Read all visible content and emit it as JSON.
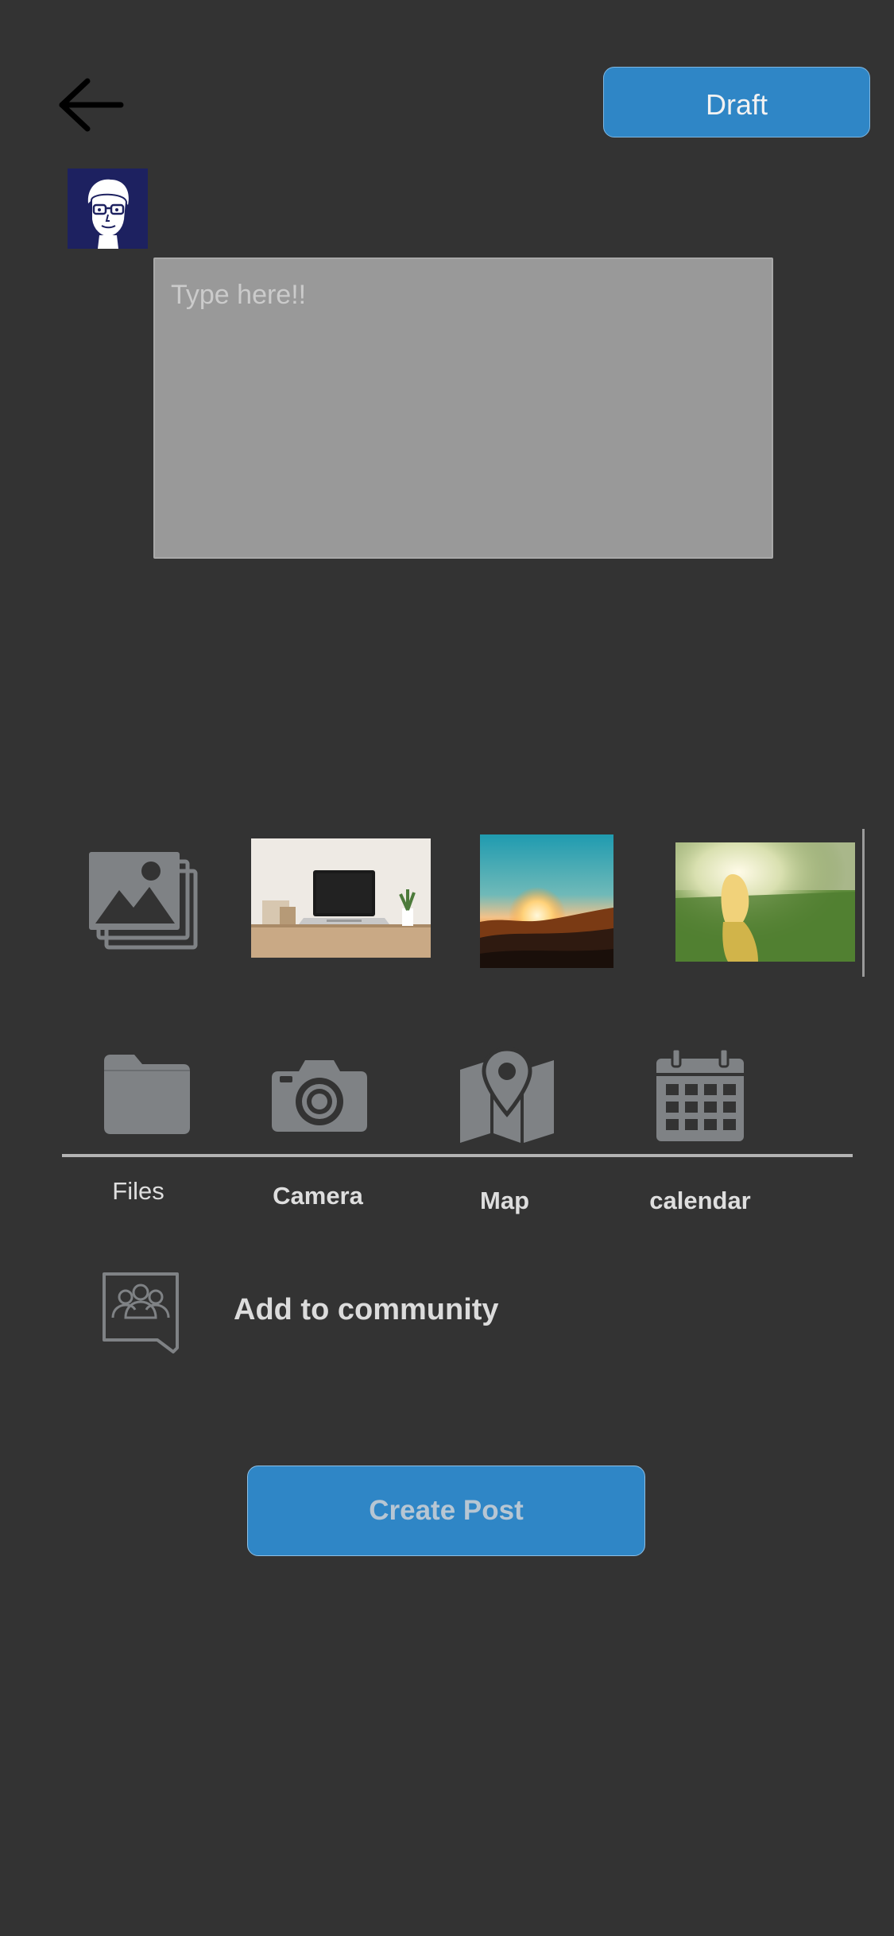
{
  "header": {
    "back_icon": "arrow-left-icon",
    "draft_label": "Draft",
    "avatar_icon": "user-avatar"
  },
  "composer": {
    "placeholder": "Type here!!",
    "value": ""
  },
  "media": {
    "gallery_icon": "image-gallery-icon",
    "thumbnails": [
      "laptop-on-desk-photo",
      "sunset-photo",
      "girl-in-field-photo"
    ]
  },
  "tools": [
    {
      "label": "Files",
      "icon": "folder-icon"
    },
    {
      "label": "Camera",
      "icon": "camera-icon"
    },
    {
      "label": "Map",
      "icon": "map-pin-icon"
    },
    {
      "label": "calendar",
      "icon": "calendar-icon"
    }
  ],
  "community": {
    "icon": "community-chat-icon",
    "label": "Add to community"
  },
  "footer": {
    "create_label": "Create Post"
  },
  "colors": {
    "background": "#333333",
    "accent": "#2f86c6",
    "input_background": "#999999",
    "icon_gray": "#7f8285"
  }
}
